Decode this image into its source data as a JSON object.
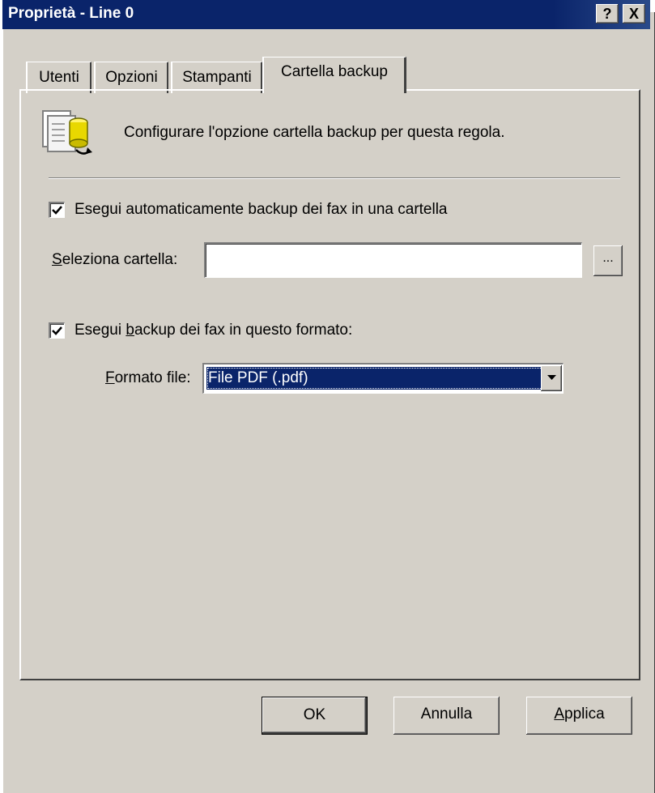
{
  "window": {
    "title": "Proprietà - Line 0",
    "help_label": "?",
    "close_label": "X"
  },
  "tabs": [
    {
      "label": "Utenti"
    },
    {
      "label": "Opzioni"
    },
    {
      "label": "Stampanti"
    },
    {
      "label": "Cartella backup",
      "active": true
    }
  ],
  "header": {
    "description": "Configurare l'opzione cartella backup per questa regola.",
    "icon": "backup-folder-icon"
  },
  "auto_backup": {
    "checked": true,
    "label": "Esegui automaticamente backup dei fax in una cartella"
  },
  "folder": {
    "label_mnemonic": "S",
    "label_rest": "eleziona cartella:",
    "value": "",
    "browse_label": "..."
  },
  "format_backup": {
    "checked": true,
    "label_pre": "Esegui ",
    "label_mnemonic": "b",
    "label_post": "ackup dei fax in questo formato:"
  },
  "file_format": {
    "label_mnemonic": "F",
    "label_rest": "ormato file:",
    "selected": "File PDF (.pdf)"
  },
  "buttons": {
    "ok": "OK",
    "cancel": "Annulla",
    "apply_mnemonic": "A",
    "apply_rest": "pplica"
  },
  "colors": {
    "dialog_bg": "#d4d0c8",
    "titlebar": "#0a246a",
    "selection": "#0a246a"
  }
}
